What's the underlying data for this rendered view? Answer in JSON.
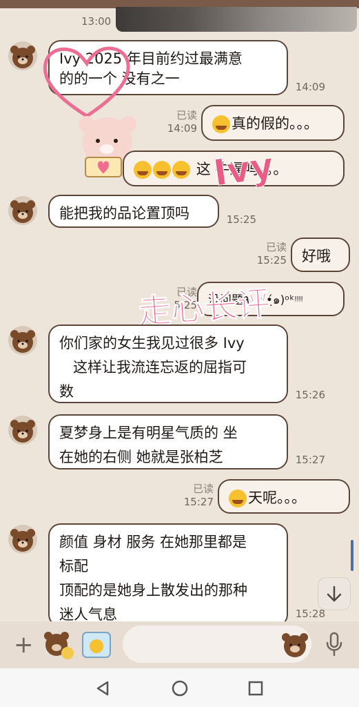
{
  "messages": {
    "top_time": "13:00",
    "m1": {
      "text_line1": "Ivy  2025 年目前约过最满意",
      "text_line2": "的的一个 没有之一",
      "time": "14:09"
    },
    "m2": {
      "read": "已读",
      "time": "14:09",
      "text": "真的假的。。。"
    },
    "m3": {
      "text": "这   牛逼吗。。。"
    },
    "m4": {
      "text": "能把我的品论置顶吗",
      "time": "15:25"
    },
    "m5": {
      "read": "已读",
      "time": "15:25",
      "text": "好哦"
    },
    "m6": {
      "read": "已读",
      "time": "5:25",
      "text": "没问题٩(•̤̀ᵕ•̤́๑)ᵒᵏᵎᵎᵎᵎ"
    },
    "m7": {
      "line1": "你们家的女生我见过很多 Ivy",
      "line2": "   这样让我流连忘返的屈指可",
      "line3": "数",
      "time": "15:26"
    },
    "m8": {
      "line1": "夏梦身上是有明星气质的 坐",
      "line2": "在她的右侧 她就是张柏芝",
      "time": "15:27"
    },
    "m9": {
      "read": "已读",
      "time": "15:27",
      "text": "天呢。。。"
    },
    "m10": {
      "line1": "颜值 身材 服务 在她那里都是",
      "line2": "标配",
      "line3": "顶配的是她身上散发出的那种",
      "line4": "迷人气息",
      "time": "15:28"
    }
  },
  "stickers": {
    "ivy": "Ivy",
    "banner": "走心长评"
  },
  "input_bar": {
    "plus": "+"
  },
  "icons": [
    "brown-bear-avatar-icon",
    "crying-emoji-icon",
    "sticker-icon",
    "microphone-icon",
    "chevron-down-icon",
    "back-icon",
    "home-icon",
    "recents-icon"
  ],
  "colors": {
    "chat_background": "#ede4da",
    "bubble_border": "#5a4638",
    "sticker_pink": "#e85d86",
    "accent_blue": "#4f6fa6"
  }
}
